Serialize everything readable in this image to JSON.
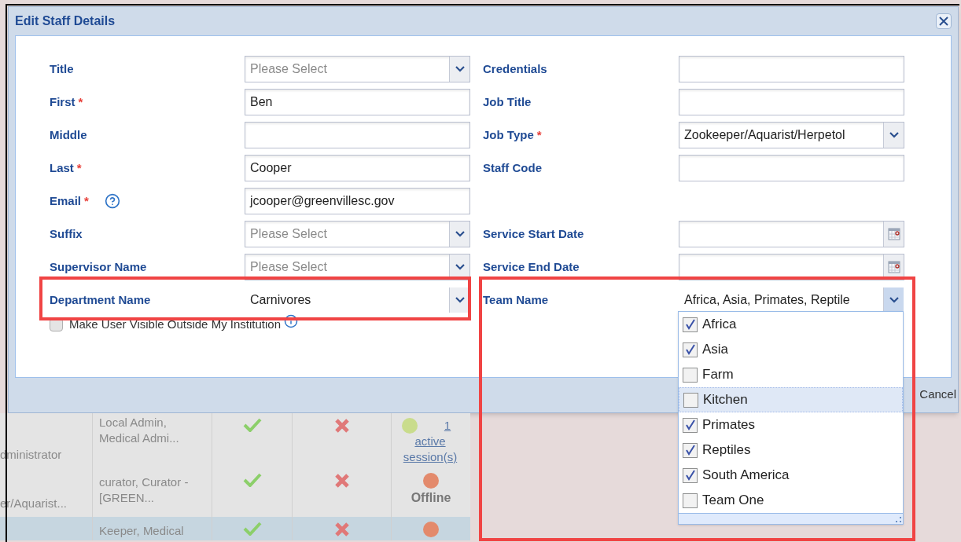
{
  "window": {
    "title": "Edit Staff Details"
  },
  "form": {
    "left_fields": [
      {
        "label": "Title",
        "kind": "select",
        "placeholder": "Please Select"
      },
      {
        "label": "First",
        "required_mark": "*",
        "kind": "text",
        "value": "Ben"
      },
      {
        "label": "Middle",
        "kind": "text"
      },
      {
        "label": "Last",
        "required_mark": "*",
        "kind": "text",
        "value": "Cooper"
      },
      {
        "label": "Email",
        "required_mark": "*",
        "help": true,
        "kind": "text",
        "value": "jcooper@greenvillesc.gov"
      },
      {
        "label": "Suffix",
        "kind": "select",
        "placeholder": "Please Select"
      },
      {
        "label": "Supervisor Name",
        "kind": "select",
        "placeholder": "Please Select"
      },
      {
        "label": "Department Name",
        "kind": "select",
        "value": "Carnivores",
        "highlighted": true
      }
    ],
    "right_fields": [
      {
        "label": "Credentials",
        "kind": "text"
      },
      {
        "label": "Job Title",
        "kind": "text"
      },
      {
        "label": "Job Type",
        "required_mark": "*",
        "kind": "select",
        "value": "Zookeeper/Aquarist/Herpetol"
      },
      {
        "label": "Staff Code",
        "kind": "text"
      },
      {
        "label": "Service Start Date",
        "kind": "date"
      },
      {
        "label": "Service End Date",
        "kind": "date"
      },
      {
        "label": "Team Name",
        "kind": "select",
        "value": "Africa, Asia, Primates, Reptile",
        "highlighted": true,
        "expanded": true
      }
    ],
    "visibility_checkbox": {
      "label": "Make User Visible Outside My Institution",
      "checked": false
    }
  },
  "team_options": [
    {
      "label": "Africa",
      "checked": true,
      "hovered": false
    },
    {
      "label": "Asia",
      "checked": true,
      "hovered": false
    },
    {
      "label": "Farm",
      "checked": false,
      "hovered": false
    },
    {
      "label": "Kitchen",
      "checked": false,
      "hovered": true
    },
    {
      "label": "Primates",
      "checked": true,
      "hovered": false
    },
    {
      "label": "Reptiles",
      "checked": true,
      "hovered": false
    },
    {
      "label": "South America",
      "checked": true,
      "hovered": false
    },
    {
      "label": "Team One",
      "checked": false,
      "hovered": false
    }
  ],
  "footer": {
    "buttons": [
      "Cancel"
    ]
  },
  "background_table": {
    "rows": [
      {
        "column_1": "dministrator",
        "column_2": "Local Admin, Medical Admi...",
        "status": {
          "color": "#c9dc8c",
          "link": "1 active session(s)"
        },
        "selected": false
      },
      {
        "column_1": "er/Aquarist...",
        "column_2": "curator, Curator - [GREEN...",
        "status": {
          "color": "#e38a6c",
          "text": "Offline"
        },
        "selected": false
      },
      {
        "column_2": "Keeper, Medical",
        "status": {
          "color": "#e38a6c"
        },
        "selected": true
      }
    ]
  }
}
